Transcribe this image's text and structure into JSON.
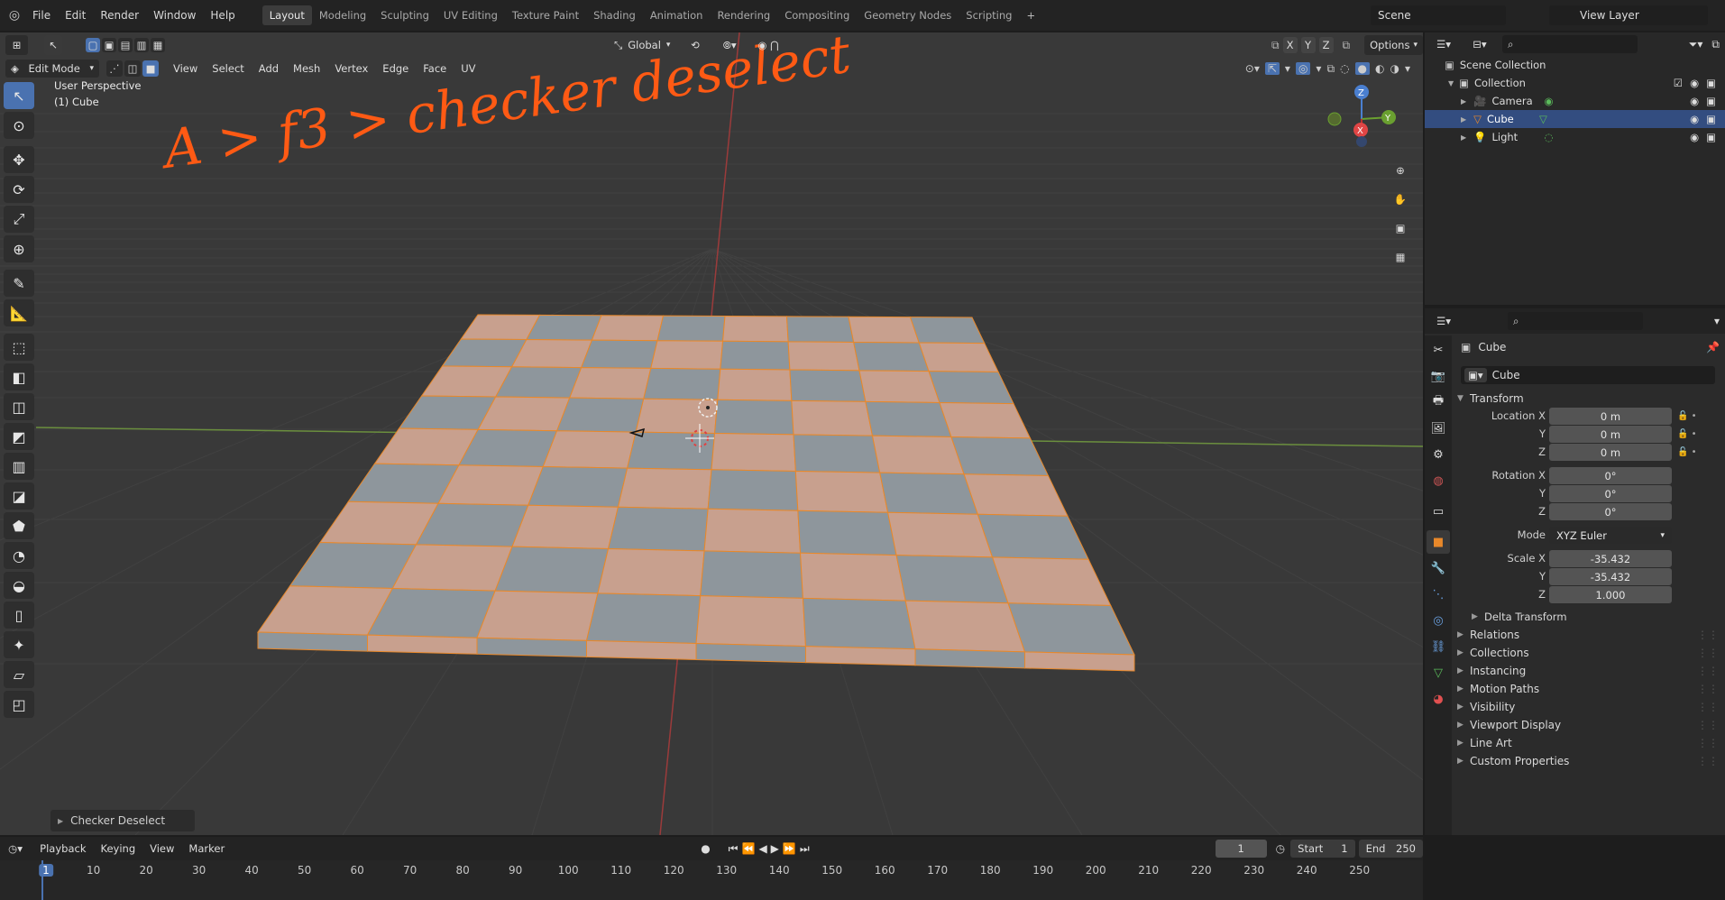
{
  "menu": [
    "File",
    "Edit",
    "Render",
    "Window",
    "Help"
  ],
  "workspaces": [
    {
      "label": "Layout",
      "active": true
    },
    {
      "label": "Modeling"
    },
    {
      "label": "Sculpting"
    },
    {
      "label": "UV Editing"
    },
    {
      "label": "Texture Paint"
    },
    {
      "label": "Shading"
    },
    {
      "label": "Animation"
    },
    {
      "label": "Rendering"
    },
    {
      "label": "Compositing"
    },
    {
      "label": "Geometry Nodes"
    },
    {
      "label": "Scripting"
    }
  ],
  "scene": {
    "label": "Scene",
    "view_layer": "View Layer"
  },
  "viewport": {
    "mode": "Edit Mode",
    "menus": [
      "View",
      "Select",
      "Add",
      "Mesh",
      "Vertex",
      "Edge",
      "Face",
      "UV"
    ],
    "orientation": "Global",
    "options": "Options",
    "xyz": [
      "X",
      "Y",
      "Z"
    ],
    "info_line1": "User Perspective",
    "info_line2": "(1) Cube",
    "annotation": "A  > f3 > checker deselect",
    "operator_panel": "Checker Deselect",
    "gizmo": {
      "x": "X",
      "y": "Y",
      "z": "Z"
    }
  },
  "outliner": {
    "root": "Scene Collection",
    "collection": "Collection",
    "items": [
      {
        "label": "Camera",
        "selected": false
      },
      {
        "label": "Cube",
        "selected": true
      },
      {
        "label": "Light",
        "selected": false
      }
    ]
  },
  "properties": {
    "object_name": "Cube",
    "data_name": "Cube",
    "transform_title": "Transform",
    "location": {
      "label": "Location X",
      "x": "0 m",
      "y": "0 m",
      "z": "0 m"
    },
    "rotation": {
      "label": "Rotation X",
      "x": "0°",
      "y": "0°",
      "z": "0°"
    },
    "mode": {
      "label": "Mode",
      "value": "XYZ Euler"
    },
    "scale": {
      "label": "Scale X",
      "x": "-35.432",
      "y": "-35.432",
      "z": "1.000"
    },
    "axis_y": "Y",
    "axis_z": "Z",
    "delta": "Delta Transform",
    "panels": [
      "Relations",
      "Collections",
      "Instancing",
      "Motion Paths",
      "Visibility",
      "Viewport Display",
      "Line Art",
      "Custom Properties"
    ]
  },
  "timeline": {
    "menus": [
      "Playback",
      "Keying",
      "View",
      "Marker"
    ],
    "current_frame": "1",
    "start_label": "Start",
    "start": "1",
    "end_label": "End",
    "end": "250",
    "ticks": [
      "1",
      "10",
      "20",
      "30",
      "40",
      "50",
      "60",
      "70",
      "80",
      "90",
      "100",
      "110",
      "120",
      "130",
      "140",
      "150",
      "160",
      "170",
      "180",
      "190",
      "200",
      "210",
      "220",
      "230",
      "240",
      "250"
    ]
  },
  "colors": {
    "accent": "#4a72b0",
    "annotation": "#ff5a14",
    "mesh_face_selected": "#c8a08e",
    "mesh_face": "#8e969c",
    "edge": "#e8882a"
  }
}
